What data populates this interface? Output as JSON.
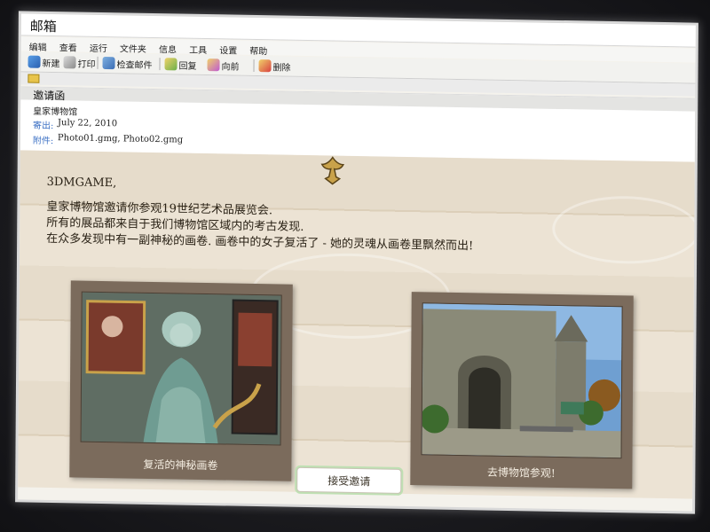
{
  "window": {
    "title": "邮箱"
  },
  "menu": [
    "编辑",
    "查看",
    "运行",
    "文件夹",
    "信息",
    "工具",
    "设置",
    "帮助"
  ],
  "toolbar": {
    "new": "新建",
    "print": "打印",
    "check_mail": "检查邮件",
    "reply": "回复",
    "forward": "向前",
    "delete": "删除"
  },
  "message": {
    "subject": "邀请函",
    "from": "皇家博物馆",
    "date_label": "寄出:",
    "date": "July 22, 2010",
    "attachment_label": "附件:",
    "attachments": "Photo01.gmg, Photo02.gmg"
  },
  "letter": {
    "greeting": "3DMGAME,",
    "line1": "皇家博物馆邀请你参观19世纪艺术品展览会.",
    "line2": "所有的展品都来自于我们博物馆区域内的考古发现.",
    "line3": "在众多发现中有一副神秘的画卷. 画卷中的女子复活了 - 她的灵魂从画卷里飘然而出!"
  },
  "cards": [
    {
      "caption": "复活的神秘画卷"
    },
    {
      "caption": "去博物馆参观!"
    }
  ],
  "accept_button": "接受邀请",
  "colors": {
    "link_blue": "#3a6fc4",
    "card_brown": "#7b6b5c",
    "parchment": "#e6dccb"
  }
}
